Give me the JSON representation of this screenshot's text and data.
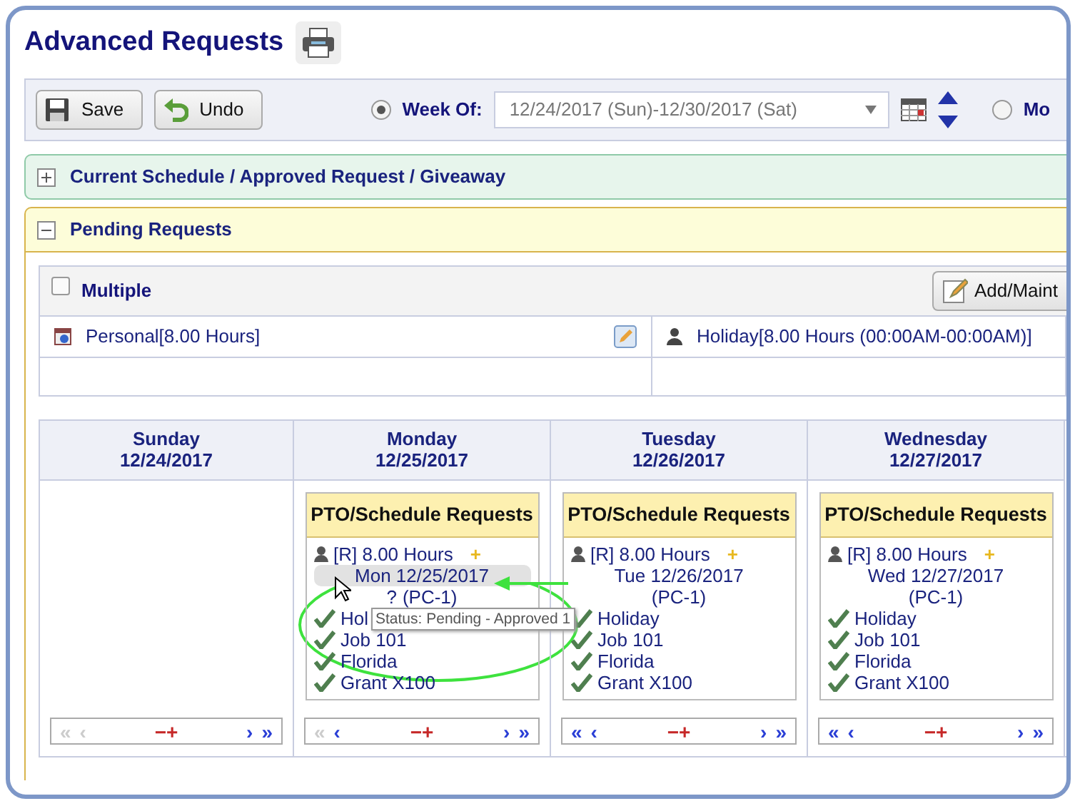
{
  "title": "Advanced Requests",
  "toolbar": {
    "buttons": [
      {
        "kind": "save",
        "label": "Save"
      },
      {
        "kind": "undo",
        "label": "Undo"
      }
    ],
    "period_options": [
      {
        "kind": "week",
        "label": "Week Of:",
        "selected": true,
        "value": "12/24/2017 (Sun)-12/30/2017 (Sat)"
      },
      {
        "kind": "month",
        "label": "Mo",
        "selected": false
      }
    ]
  },
  "sections": [
    {
      "title": "Current Schedule / Approved Request / Giveaway",
      "expanded": false,
      "kind": "approved"
    },
    {
      "title": "Pending Requests",
      "expanded": true,
      "kind": "pending"
    }
  ],
  "pending": {
    "multiple": {
      "label": "Multiple",
      "checked": false
    },
    "add_button": "Add/Maint",
    "requests": [
      {
        "kind": "personal",
        "text": "Personal[8.00 Hours]",
        "editable": true
      },
      {
        "kind": "person",
        "text": "Holiday[8.00 Hours (00:00AM-00:00AM)]",
        "editable": false
      }
    ]
  },
  "days": [
    {
      "name": "Sunday",
      "date": "12/24/2017",
      "pager": {
        "first": "«",
        "prev": "‹",
        "remove": "−",
        "add": "+",
        "next": "›",
        "last": "»",
        "first_enabled": false,
        "prev_enabled": false
      }
    },
    {
      "name": "Monday",
      "date": "12/25/2017",
      "card": {
        "title": "PTO/Schedule Requests",
        "hours": "[R] 8.00 Hours",
        "add": "+",
        "date_line": "Mon 12/25/2017",
        "selected": true,
        "help": "?",
        "code": "(PC-1)",
        "items": [
          "Hol",
          "Job 101",
          "Florida",
          "Grant X100"
        ]
      },
      "pager": {
        "first": "«",
        "prev": "‹",
        "remove": "−",
        "add": "+",
        "next": "›",
        "last": "»",
        "first_enabled": false,
        "prev_enabled": true
      }
    },
    {
      "name": "Tuesday",
      "date": "12/26/2017",
      "card": {
        "title": "PTO/Schedule Requests",
        "hours": "[R] 8.00 Hours",
        "add": "+",
        "date_line": "Tue 12/26/2017",
        "selected": false,
        "code": "(PC-1)",
        "items": [
          "Holiday",
          "Job 101",
          "Florida",
          "Grant X100"
        ]
      },
      "pager": {
        "first": "«",
        "prev": "‹",
        "remove": "−",
        "add": "+",
        "next": "›",
        "last": "»",
        "first_enabled": true,
        "prev_enabled": true
      }
    },
    {
      "name": "Wednesday",
      "date": "12/27/2017",
      "card": {
        "title": "PTO/Schedule Requests",
        "hours": "[R] 8.00 Hours",
        "add": "+",
        "date_line": "Wed 12/27/2017",
        "selected": false,
        "code": "(PC-1)",
        "items": [
          "Holiday",
          "Job 101",
          "Florida",
          "Grant X100"
        ]
      },
      "pager": {
        "first": "«",
        "prev": "‹",
        "remove": "−",
        "add": "+",
        "next": "›",
        "last": "»",
        "first_enabled": true,
        "prev_enabled": true
      }
    }
  ],
  "tooltip": "Status: Pending - Approved 1"
}
